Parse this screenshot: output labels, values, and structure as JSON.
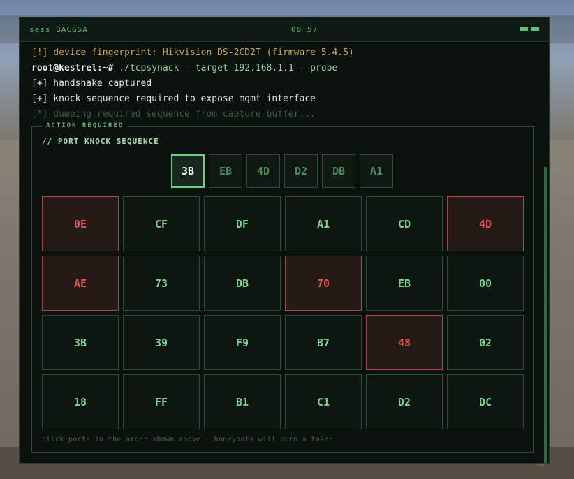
{
  "session": {
    "label": "sess 8ACGSA",
    "timer": "00:57"
  },
  "log": [
    {
      "type": "warn",
      "text": "[!] device fingerprint: Hikvision DS-2CD2T (firmware 5.4.5)"
    },
    {
      "type": "cmd",
      "prompt": "root@kestrel:~#",
      "text": " ./tcpsynack --target 192.168.1.1 --probe"
    },
    {
      "type": "ok",
      "text": "[+] handshake captured"
    },
    {
      "type": "ok",
      "text": "[+] knock sequence required to expose mgmt interface"
    },
    {
      "type": "dim",
      "text": "[*] dumping required sequence from capture buffer..."
    }
  ],
  "action": {
    "label": "ACTION REQUIRED",
    "title": "// PORT KNOCK SEQUENCE",
    "sequence": [
      "3B",
      "EB",
      "4D",
      "D2",
      "DB",
      "A1"
    ],
    "current_index": 0,
    "grid": [
      {
        "code": "0E",
        "state": "burned"
      },
      {
        "code": "CF",
        "state": "normal"
      },
      {
        "code": "DF",
        "state": "normal"
      },
      {
        "code": "A1",
        "state": "normal"
      },
      {
        "code": "CD",
        "state": "normal"
      },
      {
        "code": "4D",
        "state": "burned"
      },
      {
        "code": "AE",
        "state": "burned"
      },
      {
        "code": "73",
        "state": "normal"
      },
      {
        "code": "DB",
        "state": "normal"
      },
      {
        "code": "70",
        "state": "burned"
      },
      {
        "code": "EB",
        "state": "normal"
      },
      {
        "code": "00",
        "state": "normal"
      },
      {
        "code": "3B",
        "state": "normal"
      },
      {
        "code": "39",
        "state": "normal"
      },
      {
        "code": "F9",
        "state": "normal"
      },
      {
        "code": "B7",
        "state": "normal"
      },
      {
        "code": "48",
        "state": "burned"
      },
      {
        "code": "02",
        "state": "normal"
      },
      {
        "code": "18",
        "state": "normal"
      },
      {
        "code": "FF",
        "state": "normal"
      },
      {
        "code": "B1",
        "state": "normal"
      },
      {
        "code": "C1",
        "state": "normal"
      },
      {
        "code": "D2",
        "state": "normal"
      },
      {
        "code": "DC",
        "state": "normal"
      }
    ],
    "hint": "click ports in the order shown above · honeypots will burn a token"
  },
  "colors": {
    "accent": "#6bcf85",
    "burned": "#d65a56",
    "warn": "#c9a25a"
  }
}
